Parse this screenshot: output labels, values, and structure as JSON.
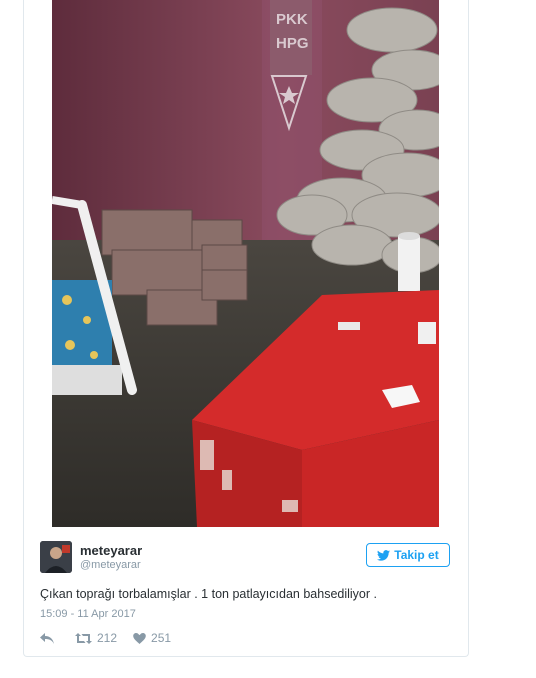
{
  "photo": {
    "wall_text_line1": "PKK",
    "wall_text_line2": "HPG"
  },
  "tweet": {
    "display_name": "meteyarar",
    "handle": "@meteyarar",
    "follow_label": "Takip et",
    "text": "Çıkan toprağı torbalamışlar . 1 ton patlayıcıdan bahsediliyor .",
    "timestamp": "15:09 - 11 Apr 2017",
    "retweet_count": "212",
    "like_count": "251"
  },
  "colors": {
    "accent": "#1da1f2",
    "muted": "#8899a6",
    "text": "#292f33"
  },
  "icons": {
    "reply": "reply-icon",
    "retweet": "retweet-icon",
    "like": "heart-icon",
    "follow": "twitter-bird-icon"
  }
}
